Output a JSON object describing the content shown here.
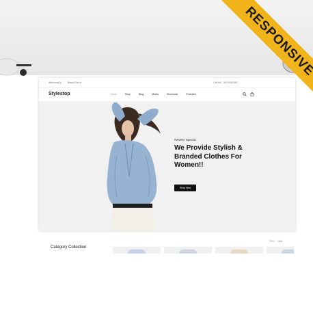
{
  "ribbon": {
    "label": "RESPONSIVE",
    "color": "#f1b41a"
  },
  "topbar": {
    "left_items": [
      "Welcome(0)",
      "Brand Pink ▾"
    ],
    "right_items": [
      "Call toll - 000 0000 987"
    ]
  },
  "header": {
    "logo": "Stylestop",
    "nav": [
      {
        "label": "Home"
      },
      {
        "label": "Shop"
      },
      {
        "label": "Blog"
      },
      {
        "label": "Media"
      },
      {
        "label": "Shortcode"
      },
      {
        "label": "Features"
      }
    ]
  },
  "hero": {
    "tag": "#Winter Special",
    "title": "We Provide Stylish & Branded Clothes For Women!!",
    "button": "Shop Now"
  },
  "collection": {
    "title": "Category Collection",
    "pager_prev": "Prev",
    "pager_next": "Next",
    "thumb_colors": [
      "#c7d5e6",
      "#cfd6df",
      "#e9d9c3",
      "#cbd6e6"
    ]
  },
  "colors": {
    "accent": "#f1b41a",
    "dark": "#111111",
    "hero_bg": "#f1f1f1"
  }
}
